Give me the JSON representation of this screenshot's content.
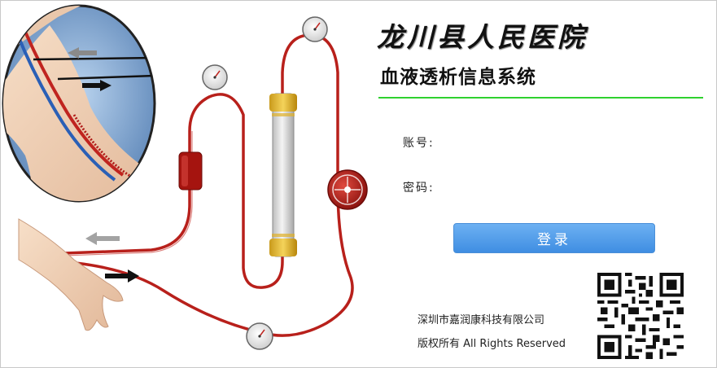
{
  "header": {
    "hospital_name": "龙川县人民医院",
    "system_name": "血液透析信息系统"
  },
  "login": {
    "account_label": "账号:",
    "account_value": "",
    "password_label": "密码:",
    "password_value": "",
    "submit_label": "登录"
  },
  "footer": {
    "company": "深圳市嘉润康科技有限公司",
    "copyright": "版权所有 All Rights Reserved"
  },
  "colors": {
    "accent_line": "#2fd12f",
    "button": "#4a95e6",
    "blood_tube": "#c0241f"
  },
  "icons": [
    "dialysis-illustration",
    "arm-vein-inset-icon",
    "qr-code-icon"
  ]
}
